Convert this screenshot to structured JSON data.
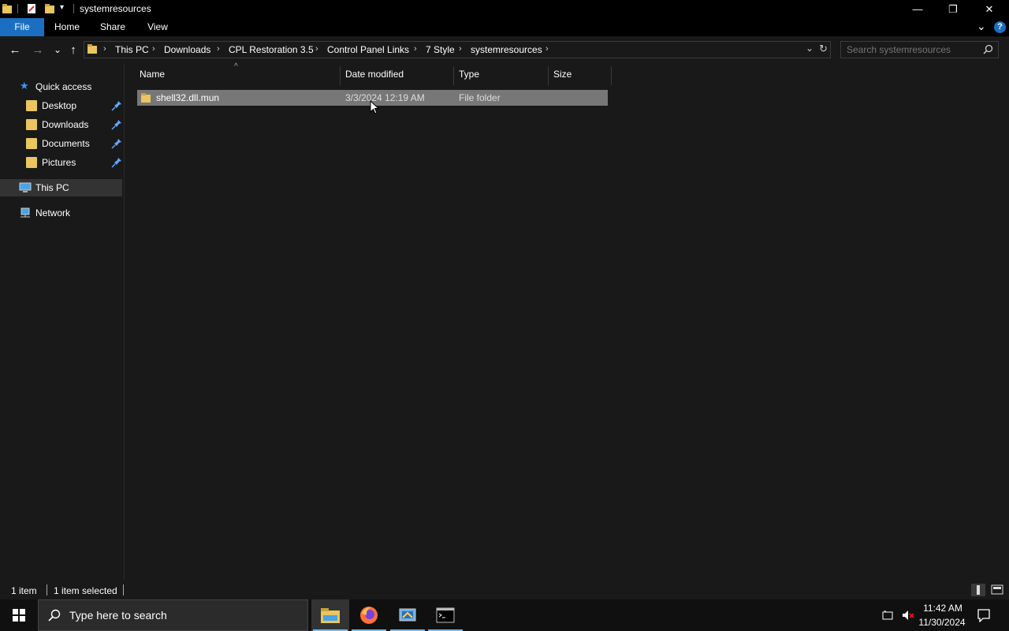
{
  "window": {
    "title": "systemresources",
    "minimize_glyph": "—",
    "restore_glyph": "❐",
    "close_glyph": "✕"
  },
  "ribbon": {
    "tabs": [
      "File",
      "Home",
      "Share",
      "View"
    ],
    "expand_glyph": "⌄",
    "help_glyph": "?"
  },
  "nav": {
    "back": "←",
    "forward": "→",
    "recent": "⌄",
    "up": "↑"
  },
  "address": {
    "crumbs": [
      "This PC",
      "Downloads",
      "CPL Restoration 3.5",
      "Control Panel Links",
      "7 Style",
      "systemresources"
    ],
    "separator": "›",
    "dropdown_glyph": "⌄",
    "refresh_glyph": "↻"
  },
  "search": {
    "placeholder": "Search systemresources",
    "icon": "search-icon"
  },
  "sidebar": {
    "quick_access": "Quick access",
    "items": [
      {
        "label": "Desktop",
        "pinned": true
      },
      {
        "label": "Downloads",
        "pinned": true
      },
      {
        "label": "Documents",
        "pinned": true
      },
      {
        "label": "Pictures",
        "pinned": true
      }
    ],
    "this_pc": "This PC",
    "network": "Network",
    "pin_glyph": "📌"
  },
  "file_list": {
    "columns": [
      "Name",
      "Date modified",
      "Type",
      "Size"
    ],
    "sort_glyph": "^",
    "rows": [
      {
        "name": "shell32.dll.mun",
        "date": "3/3/2024 12:19 AM",
        "type": "File folder",
        "size": ""
      }
    ]
  },
  "status": {
    "count": "1 item",
    "selected": "1 item selected"
  },
  "taskbar": {
    "search_placeholder": "Type here to search",
    "apps": [
      "file-explorer-icon",
      "firefox-icon",
      "control-panel-icon",
      "terminal-icon"
    ],
    "time": "11:42 AM",
    "date": "11/30/2024"
  },
  "colors": {
    "accent": "#1a6fc2",
    "selection": "#777777",
    "background": "#191919",
    "taskbar_underline": "#76b9ed"
  }
}
